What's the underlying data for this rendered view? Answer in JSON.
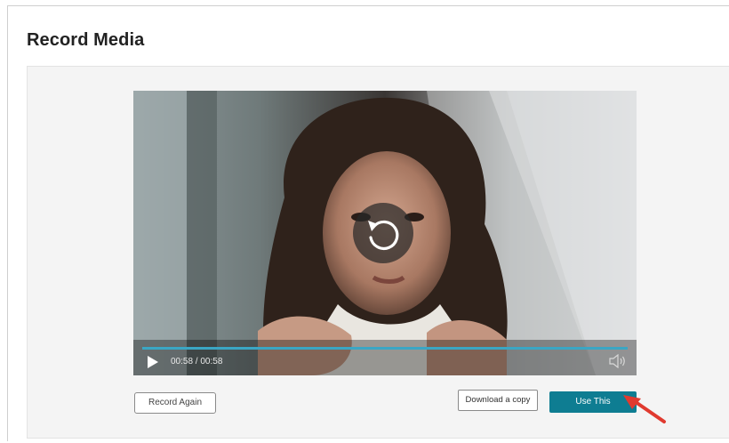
{
  "page": {
    "title": "Record Media"
  },
  "player": {
    "time_display": "00:58 / 00:58",
    "progress": 1.0,
    "accent_color": "#3aa6c4",
    "icons": {
      "replay": "replay-icon",
      "play": "play-icon",
      "volume": "volume-icon"
    }
  },
  "actions": {
    "record_again_label": "Record Again",
    "download_label": "Download a copy",
    "use_this_label": "Use This",
    "primary_color": "#0e7d92"
  },
  "annotation": {
    "icon": "red-arrow-annotation",
    "color": "#e03a2f"
  }
}
